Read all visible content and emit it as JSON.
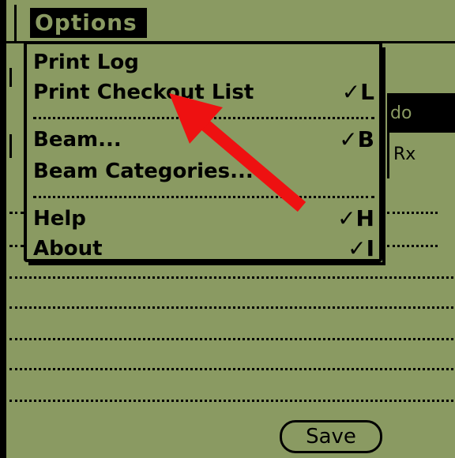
{
  "menubar": {
    "title": "Options"
  },
  "menu": {
    "items": [
      {
        "label": "Print Log",
        "shortcut": ""
      },
      {
        "label": "Print Checkout List",
        "shortcut": "✓L"
      },
      {
        "label": "Beam...",
        "shortcut": "✓B"
      },
      {
        "label": "Beam Categories...",
        "shortcut": ""
      },
      {
        "label": "Help",
        "shortcut": "✓H"
      },
      {
        "label": "About",
        "shortcut": "✓I"
      }
    ]
  },
  "background": {
    "row_highlighted": "do",
    "row_second": "Rx"
  },
  "save_button": {
    "label": "Save"
  },
  "annotation": {
    "arrow_color": "#ee1111",
    "arrow_target": "Print Checkout List"
  },
  "colors": {
    "screen": "#8a9a62",
    "ink": "#000000"
  }
}
